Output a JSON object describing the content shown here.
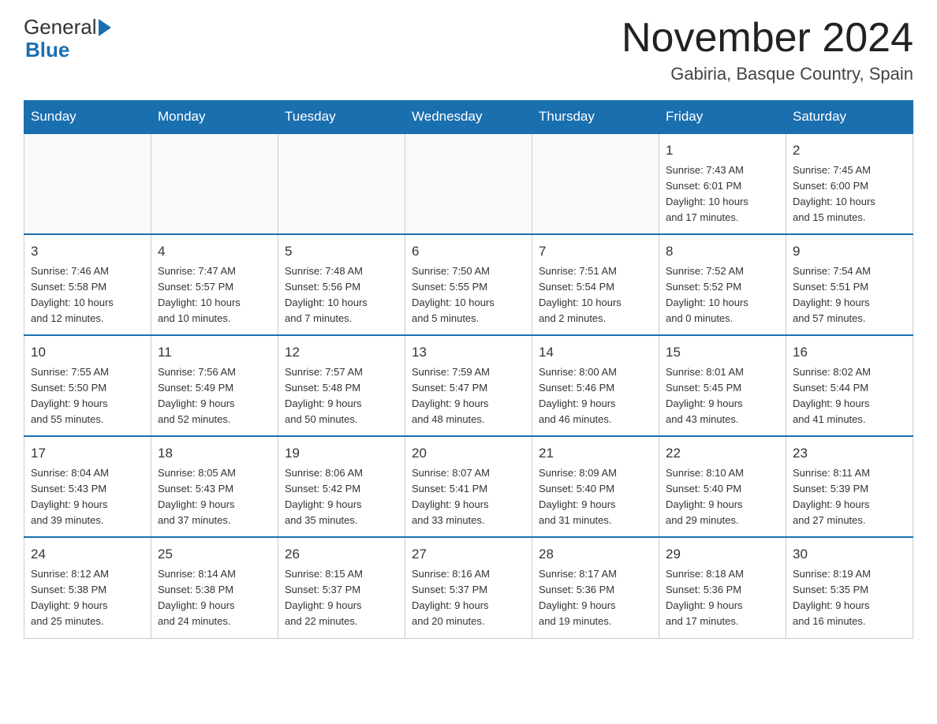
{
  "header": {
    "logo_general": "General",
    "logo_blue": "Blue",
    "month_title": "November 2024",
    "location": "Gabiria, Basque Country, Spain"
  },
  "weekdays": [
    "Sunday",
    "Monday",
    "Tuesday",
    "Wednesday",
    "Thursday",
    "Friday",
    "Saturday"
  ],
  "weeks": [
    [
      {
        "day": "",
        "info": ""
      },
      {
        "day": "",
        "info": ""
      },
      {
        "day": "",
        "info": ""
      },
      {
        "day": "",
        "info": ""
      },
      {
        "day": "",
        "info": ""
      },
      {
        "day": "1",
        "info": "Sunrise: 7:43 AM\nSunset: 6:01 PM\nDaylight: 10 hours\nand 17 minutes."
      },
      {
        "day": "2",
        "info": "Sunrise: 7:45 AM\nSunset: 6:00 PM\nDaylight: 10 hours\nand 15 minutes."
      }
    ],
    [
      {
        "day": "3",
        "info": "Sunrise: 7:46 AM\nSunset: 5:58 PM\nDaylight: 10 hours\nand 12 minutes."
      },
      {
        "day": "4",
        "info": "Sunrise: 7:47 AM\nSunset: 5:57 PM\nDaylight: 10 hours\nand 10 minutes."
      },
      {
        "day": "5",
        "info": "Sunrise: 7:48 AM\nSunset: 5:56 PM\nDaylight: 10 hours\nand 7 minutes."
      },
      {
        "day": "6",
        "info": "Sunrise: 7:50 AM\nSunset: 5:55 PM\nDaylight: 10 hours\nand 5 minutes."
      },
      {
        "day": "7",
        "info": "Sunrise: 7:51 AM\nSunset: 5:54 PM\nDaylight: 10 hours\nand 2 minutes."
      },
      {
        "day": "8",
        "info": "Sunrise: 7:52 AM\nSunset: 5:52 PM\nDaylight: 10 hours\nand 0 minutes."
      },
      {
        "day": "9",
        "info": "Sunrise: 7:54 AM\nSunset: 5:51 PM\nDaylight: 9 hours\nand 57 minutes."
      }
    ],
    [
      {
        "day": "10",
        "info": "Sunrise: 7:55 AM\nSunset: 5:50 PM\nDaylight: 9 hours\nand 55 minutes."
      },
      {
        "day": "11",
        "info": "Sunrise: 7:56 AM\nSunset: 5:49 PM\nDaylight: 9 hours\nand 52 minutes."
      },
      {
        "day": "12",
        "info": "Sunrise: 7:57 AM\nSunset: 5:48 PM\nDaylight: 9 hours\nand 50 minutes."
      },
      {
        "day": "13",
        "info": "Sunrise: 7:59 AM\nSunset: 5:47 PM\nDaylight: 9 hours\nand 48 minutes."
      },
      {
        "day": "14",
        "info": "Sunrise: 8:00 AM\nSunset: 5:46 PM\nDaylight: 9 hours\nand 46 minutes."
      },
      {
        "day": "15",
        "info": "Sunrise: 8:01 AM\nSunset: 5:45 PM\nDaylight: 9 hours\nand 43 minutes."
      },
      {
        "day": "16",
        "info": "Sunrise: 8:02 AM\nSunset: 5:44 PM\nDaylight: 9 hours\nand 41 minutes."
      }
    ],
    [
      {
        "day": "17",
        "info": "Sunrise: 8:04 AM\nSunset: 5:43 PM\nDaylight: 9 hours\nand 39 minutes."
      },
      {
        "day": "18",
        "info": "Sunrise: 8:05 AM\nSunset: 5:43 PM\nDaylight: 9 hours\nand 37 minutes."
      },
      {
        "day": "19",
        "info": "Sunrise: 8:06 AM\nSunset: 5:42 PM\nDaylight: 9 hours\nand 35 minutes."
      },
      {
        "day": "20",
        "info": "Sunrise: 8:07 AM\nSunset: 5:41 PM\nDaylight: 9 hours\nand 33 minutes."
      },
      {
        "day": "21",
        "info": "Sunrise: 8:09 AM\nSunset: 5:40 PM\nDaylight: 9 hours\nand 31 minutes."
      },
      {
        "day": "22",
        "info": "Sunrise: 8:10 AM\nSunset: 5:40 PM\nDaylight: 9 hours\nand 29 minutes."
      },
      {
        "day": "23",
        "info": "Sunrise: 8:11 AM\nSunset: 5:39 PM\nDaylight: 9 hours\nand 27 minutes."
      }
    ],
    [
      {
        "day": "24",
        "info": "Sunrise: 8:12 AM\nSunset: 5:38 PM\nDaylight: 9 hours\nand 25 minutes."
      },
      {
        "day": "25",
        "info": "Sunrise: 8:14 AM\nSunset: 5:38 PM\nDaylight: 9 hours\nand 24 minutes."
      },
      {
        "day": "26",
        "info": "Sunrise: 8:15 AM\nSunset: 5:37 PM\nDaylight: 9 hours\nand 22 minutes."
      },
      {
        "day": "27",
        "info": "Sunrise: 8:16 AM\nSunset: 5:37 PM\nDaylight: 9 hours\nand 20 minutes."
      },
      {
        "day": "28",
        "info": "Sunrise: 8:17 AM\nSunset: 5:36 PM\nDaylight: 9 hours\nand 19 minutes."
      },
      {
        "day": "29",
        "info": "Sunrise: 8:18 AM\nSunset: 5:36 PM\nDaylight: 9 hours\nand 17 minutes."
      },
      {
        "day": "30",
        "info": "Sunrise: 8:19 AM\nSunset: 5:35 PM\nDaylight: 9 hours\nand 16 minutes."
      }
    ]
  ]
}
